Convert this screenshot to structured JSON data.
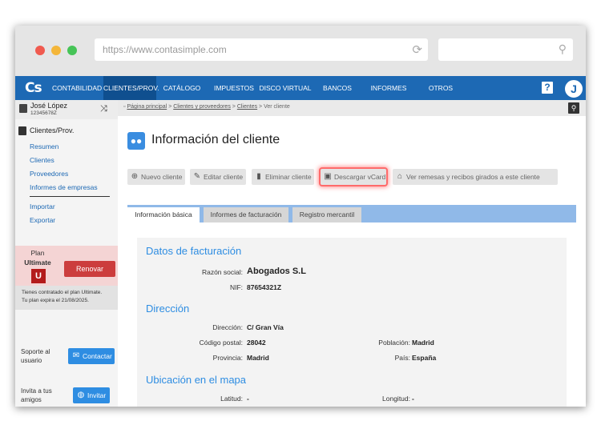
{
  "browser": {
    "url": "https://www.contasimple.com"
  },
  "nav": {
    "logo": "Cs",
    "items": [
      "CONTABILIDAD",
      "CLIENTES/PROV.",
      "CATÁLOGO",
      "IMPUESTOS",
      "DISCO VIRTUAL",
      "BANCOS",
      "INFORMES",
      "OTROS"
    ],
    "active_index": 1,
    "help": "?",
    "avatar": "J"
  },
  "user": {
    "name": "José López",
    "id": "12345678Z"
  },
  "sidebar": {
    "section": "Clientes/Prov.",
    "links": [
      "Resumen",
      "Clientes",
      "Proveedores",
      "Informes de empresas"
    ],
    "links2": [
      "Importar",
      "Exportar"
    ],
    "plan": {
      "label": "Plan",
      "name": "Ultimate",
      "badge": "U",
      "renew": "Renovar",
      "note1": "Tienes contratado el plan Ultimate.",
      "note2": "Tu plan expira el 21/08/2025."
    },
    "support": {
      "label1": "Soporte al",
      "label2": "usuario",
      "button": "Contactar"
    },
    "invite": {
      "label1": "Invita a tus",
      "label2": "amigos",
      "button": "Invitar"
    }
  },
  "breadcrumb": {
    "items": [
      "Página principal",
      "Clientes y proveedores",
      "Clientes"
    ],
    "current": "Ver cliente"
  },
  "page": {
    "title": "Información del cliente"
  },
  "actions": [
    "Nuevo cliente",
    "Editar cliente",
    "Eliminar cliente",
    "Descargar vCard",
    "Ver remesas y recibos girados a este cliente"
  ],
  "tabs": [
    "Información básica",
    "Informes de facturación",
    "Registro mercantil"
  ],
  "details": {
    "billing_title": "Datos de facturación",
    "razon_label": "Razón social:",
    "razon_value": "Abogados S.L",
    "nif_label": "NIF:",
    "nif_value": "87654321Z",
    "address_title": "Dirección",
    "direccion_label": "Dirección:",
    "direccion_value": "C/ Gran Vía",
    "cp_label": "Código postal:",
    "cp_value": "28042",
    "poblacion_label": "Población:",
    "poblacion_value": "Madrid",
    "provincia_label": "Provincia:",
    "provincia_value": "Madrid",
    "pais_label": "País:",
    "pais_value": "España",
    "map_title": "Ubicación en el mapa",
    "latitud_label": "Latitud:",
    "latitud_value": "-",
    "longitud_label": "Longitud:",
    "longitud_value": "-"
  },
  "colors": {
    "brand": "#1d69b4",
    "accent": "#2e8de2",
    "renew": "#cc3d3d",
    "highlight": "#ff6b6b"
  }
}
